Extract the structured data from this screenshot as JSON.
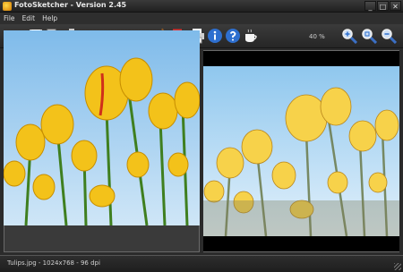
{
  "window": {
    "title": "FotoSketcher - Version 2.45",
    "buttons": [
      "_",
      "□",
      "✕"
    ]
  },
  "menu": {
    "items": [
      "File",
      "Edit",
      "Help"
    ]
  },
  "toolbar": {
    "icons": [
      "open-folder-icon",
      "save-icon",
      "copy-icon",
      "paste-icon",
      "undo-icon",
      "redo-icon",
      "image-original-icon",
      "image-result-icon",
      "palette-icon",
      "text-icon",
      "print-icon",
      "info-icon",
      "help-icon",
      "coffee-icon",
      "zoom-in-icon",
      "zoom-fit-icon",
      "zoom-out-icon"
    ],
    "zoom_label": "40 %"
  },
  "status": {
    "text": "Tulips.jpg - 1024x768 - 96 dpi"
  },
  "colors": {
    "chrome": "#2b2b2b",
    "sky": "#8fc7ee",
    "tulip": "#f3c21a",
    "stem": "#3f7f1f"
  }
}
